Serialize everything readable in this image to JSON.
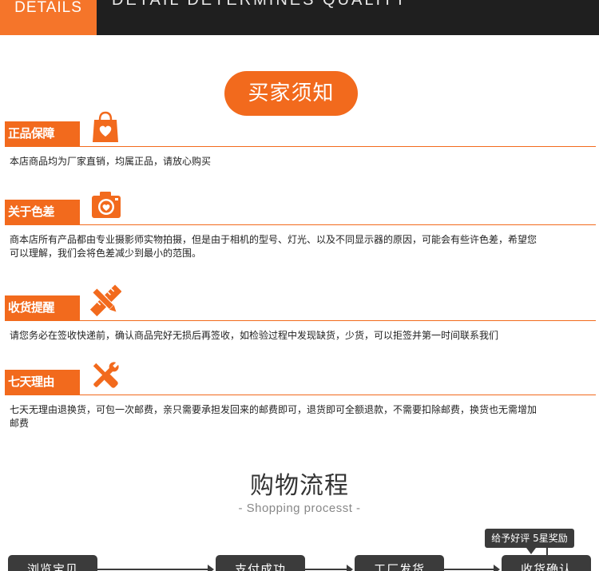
{
  "banner": {
    "tag_label": "DETAILS",
    "slogan": "DETAIL DETERMINES QUALITY"
  },
  "notice_title": "买家须知",
  "sections": [
    {
      "label": "正品保障",
      "icon": "shopping-bag-heart-icon",
      "text": "本店商品均为厂家直销，均属正品，请放心购买"
    },
    {
      "label": "关于色差",
      "icon": "camera-heart-icon",
      "text": "商本店所有产品都由专业摄影师实物拍摄，但是由于相机的型号、灯光、以及不同显示器的原因，可能会有些许色差，希望您可以理解，我们会将色差减少到最小的范围。"
    },
    {
      "label": "收货提醒",
      "icon": "pencil-ruler-icon",
      "text": "请您务必在签收快递前，确认商品完好无损后再签收，如检验过程中发现缺货，少货，可以拒签并第一时间联系我们"
    },
    {
      "label": "七天理由",
      "icon": "wrench-screwdriver-icon",
      "text": "七天无理由退换货，可包一次邮费，亲只需要承担发回来的邮费即可，退货即可全额退款，不需要扣除邮费，换货也无需增加邮费"
    }
  ],
  "flow": {
    "title": "购物流程",
    "subtitle": "- Shopping processt -",
    "steps": [
      "浏览宝贝",
      "支付成功",
      "工厂发货",
      "收货确认"
    ],
    "bubble": "给予好评 5星奖励"
  },
  "colors": {
    "accent": "#f26a1d",
    "banner_bg": "#1f1f1f",
    "step_bg": "#3b3b3b"
  }
}
